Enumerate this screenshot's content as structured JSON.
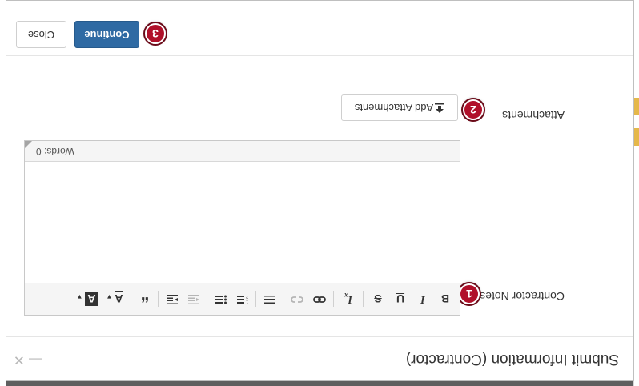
{
  "modal": {
    "title": "Submit Information (Contractor)",
    "minimize_glyph": "—",
    "close_glyph": "✕"
  },
  "form": {
    "notes_label": "Contractor Notes",
    "attachments_label": "Attachments"
  },
  "badges": {
    "notes": "1",
    "attachments": "2",
    "continue": "3"
  },
  "editor": {
    "words": "Words: 0",
    "toolbar": [
      {
        "name": "bold-button",
        "glyph": "B",
        "enabled": true
      },
      {
        "name": "italic-button",
        "glyph": "I",
        "enabled": true
      },
      {
        "name": "underline-button",
        "glyph": "U",
        "enabled": true
      },
      {
        "name": "strikethrough-button",
        "glyph": "S",
        "enabled": true
      },
      {
        "name": "remove-format-button",
        "glyph": "Ix",
        "enabled": true
      },
      {
        "name": "link-button",
        "glyph": "link-icon",
        "enabled": true
      },
      {
        "name": "unlink-button",
        "glyph": "unlink-icon",
        "enabled": false
      },
      {
        "name": "horizontal-rule-button",
        "glyph": "hr-icon",
        "enabled": true
      },
      {
        "name": "numbered-list-button",
        "glyph": "ol-icon",
        "enabled": true
      },
      {
        "name": "bulleted-list-button",
        "glyph": "ul-icon",
        "enabled": true
      },
      {
        "name": "outdent-button",
        "glyph": "outdent-icon",
        "enabled": false
      },
      {
        "name": "indent-button",
        "glyph": "indent-icon",
        "enabled": true
      },
      {
        "name": "blockquote-button",
        "glyph": "“",
        "enabled": true
      },
      {
        "name": "text-color-button",
        "glyph": "A",
        "enabled": true
      },
      {
        "name": "background-color-button",
        "glyph": "A",
        "enabled": true
      }
    ]
  },
  "buttons": {
    "add_attachments": "Add Attachments",
    "continue": "Continue",
    "close": "Close"
  },
  "colors": {
    "primary": "#2f6aa3",
    "badge": "#b0102a"
  }
}
